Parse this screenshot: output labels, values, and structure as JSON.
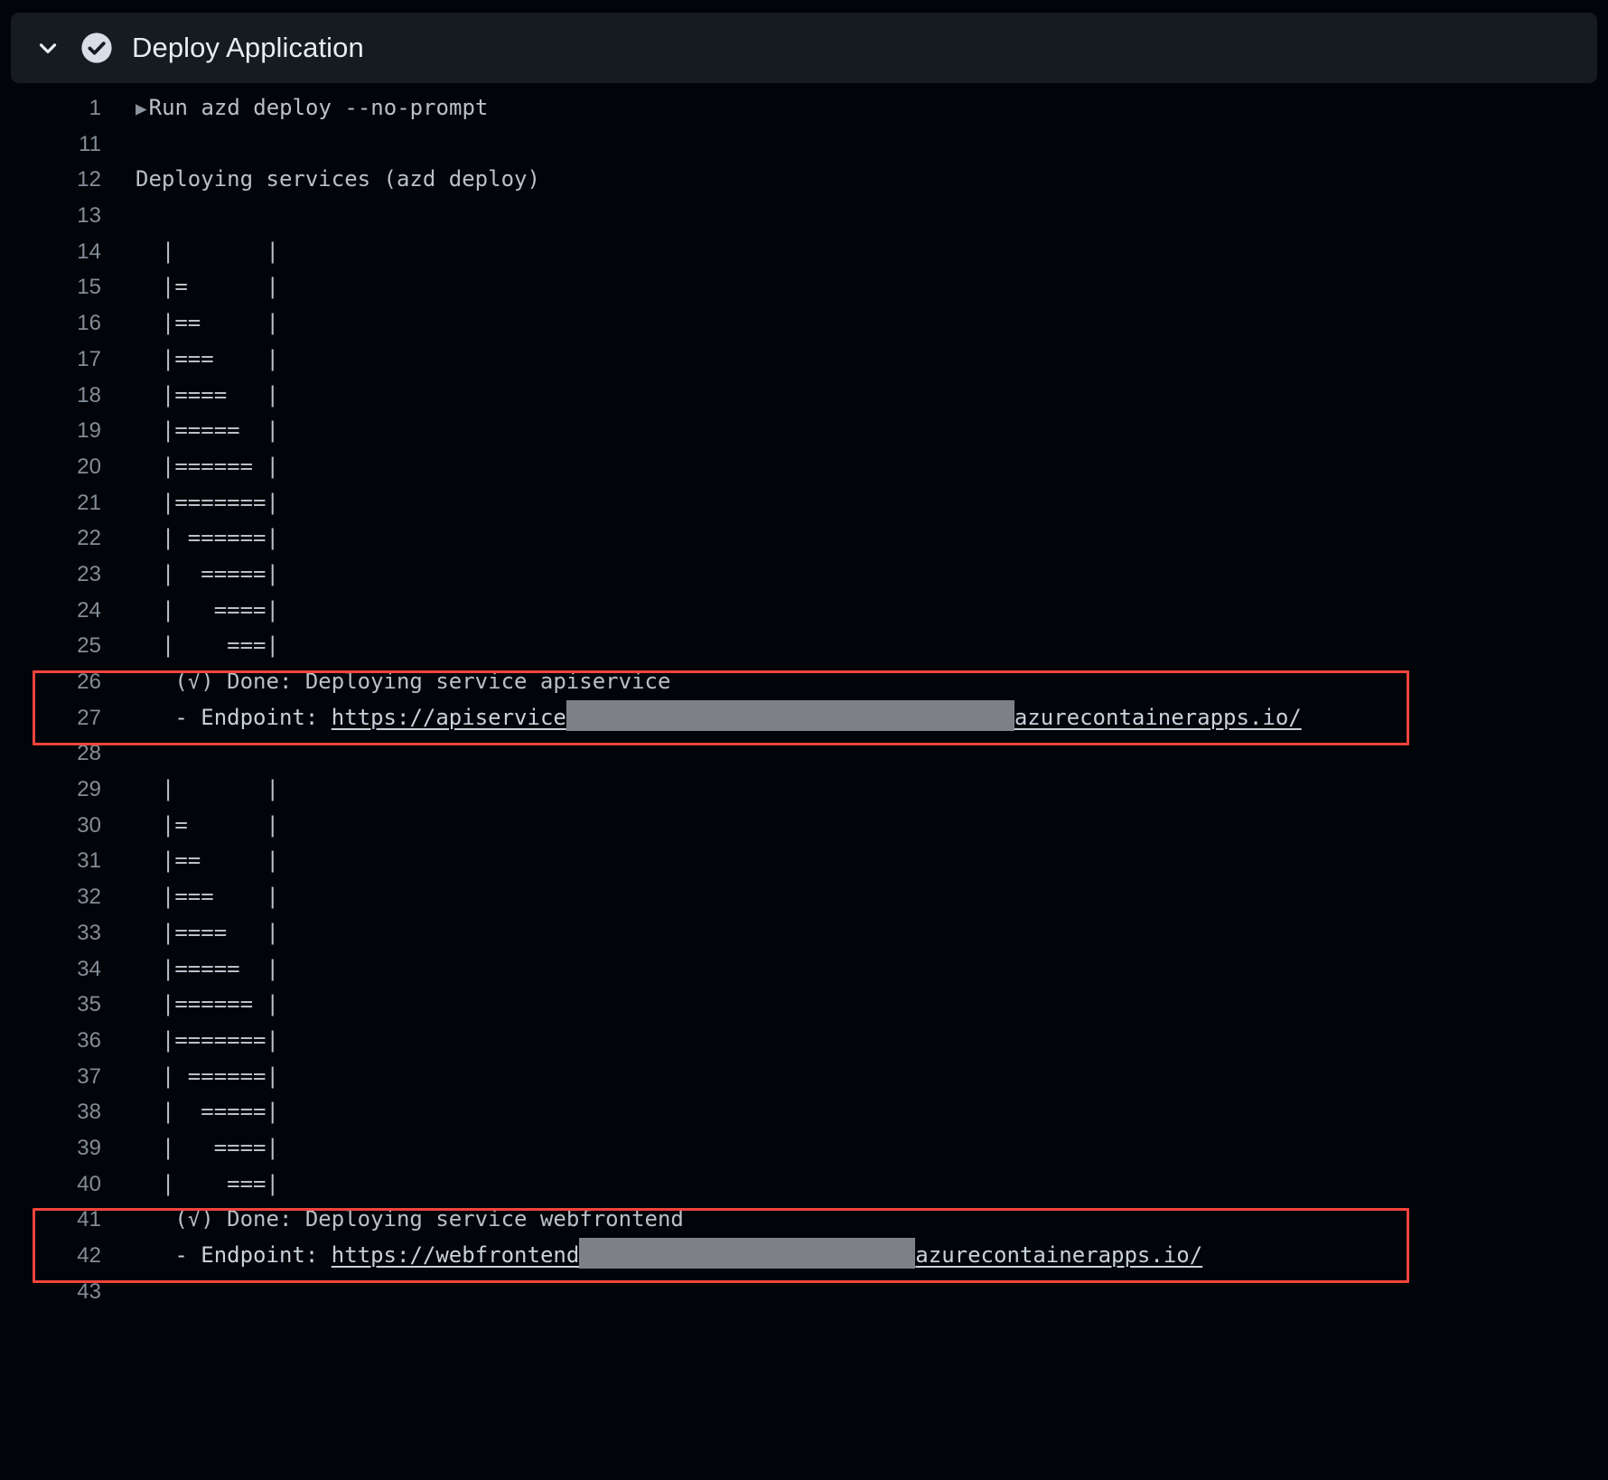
{
  "header": {
    "title": "Deploy Application",
    "chevron_icon": "chevron-down-icon",
    "status_icon": "check-circle-icon",
    "status": "success",
    "background": "#161b22"
  },
  "theme": {
    "page_background": "#010409",
    "text": "#c9d1d9",
    "line_number": "#848d97",
    "highlight_border": "#f4443c",
    "redaction": "#7d8085"
  },
  "log": {
    "lines": [
      {
        "n": "1",
        "text": "Run azd deploy --no-prompt",
        "caret": true
      },
      {
        "n": "11",
        "text": ""
      },
      {
        "n": "12",
        "text": "Deploying services (azd deploy)"
      },
      {
        "n": "13",
        "text": ""
      },
      {
        "n": "14",
        "text": "  |       |"
      },
      {
        "n": "15",
        "text": "  |=      |"
      },
      {
        "n": "16",
        "text": "  |==     |"
      },
      {
        "n": "17",
        "text": "  |===    |"
      },
      {
        "n": "18",
        "text": "  |====   |"
      },
      {
        "n": "19",
        "text": "  |=====  |"
      },
      {
        "n": "20",
        "text": "  |====== |"
      },
      {
        "n": "21",
        "text": "  |=======|"
      },
      {
        "n": "22",
        "text": "  | ======|"
      },
      {
        "n": "23",
        "text": "  |  =====|"
      },
      {
        "n": "24",
        "text": "  |   ====|"
      },
      {
        "n": "25",
        "text": "  |    ===|"
      },
      {
        "n": "26",
        "text": "   (√) Done: Deploying service apiservice"
      },
      {
        "n": "27",
        "type": "endpoint",
        "prefix": "   - Endpoint: ",
        "url_visible_start": "https://apiservice",
        "url_redacted_width": 496,
        "url_visible_end": "azurecontainerapps.io/"
      },
      {
        "n": "28",
        "text": ""
      },
      {
        "n": "29",
        "text": "  |       |"
      },
      {
        "n": "30",
        "text": "  |=      |"
      },
      {
        "n": "31",
        "text": "  |==     |"
      },
      {
        "n": "32",
        "text": "  |===    |"
      },
      {
        "n": "33",
        "text": "  |====   |"
      },
      {
        "n": "34",
        "text": "  |=====  |"
      },
      {
        "n": "35",
        "text": "  |====== |"
      },
      {
        "n": "36",
        "text": "  |=======|"
      },
      {
        "n": "37",
        "text": "  | ======|"
      },
      {
        "n": "38",
        "text": "  |  =====|"
      },
      {
        "n": "39",
        "text": "  |   ====|"
      },
      {
        "n": "40",
        "text": "  |    ===|"
      },
      {
        "n": "41",
        "text": "   (√) Done: Deploying service webfrontend"
      },
      {
        "n": "42",
        "type": "endpoint",
        "prefix": "   - Endpoint: ",
        "url_visible_start": "https://webfrontend",
        "url_redacted_width": 372,
        "url_visible_end": "azurecontainerapps.io/"
      },
      {
        "n": "43",
        "text": ""
      }
    ]
  },
  "highlights": [
    {
      "id": "hl-api",
      "label": "apiservice-endpoint-highlight"
    },
    {
      "id": "hl-web",
      "label": "webfrontend-endpoint-highlight"
    }
  ]
}
